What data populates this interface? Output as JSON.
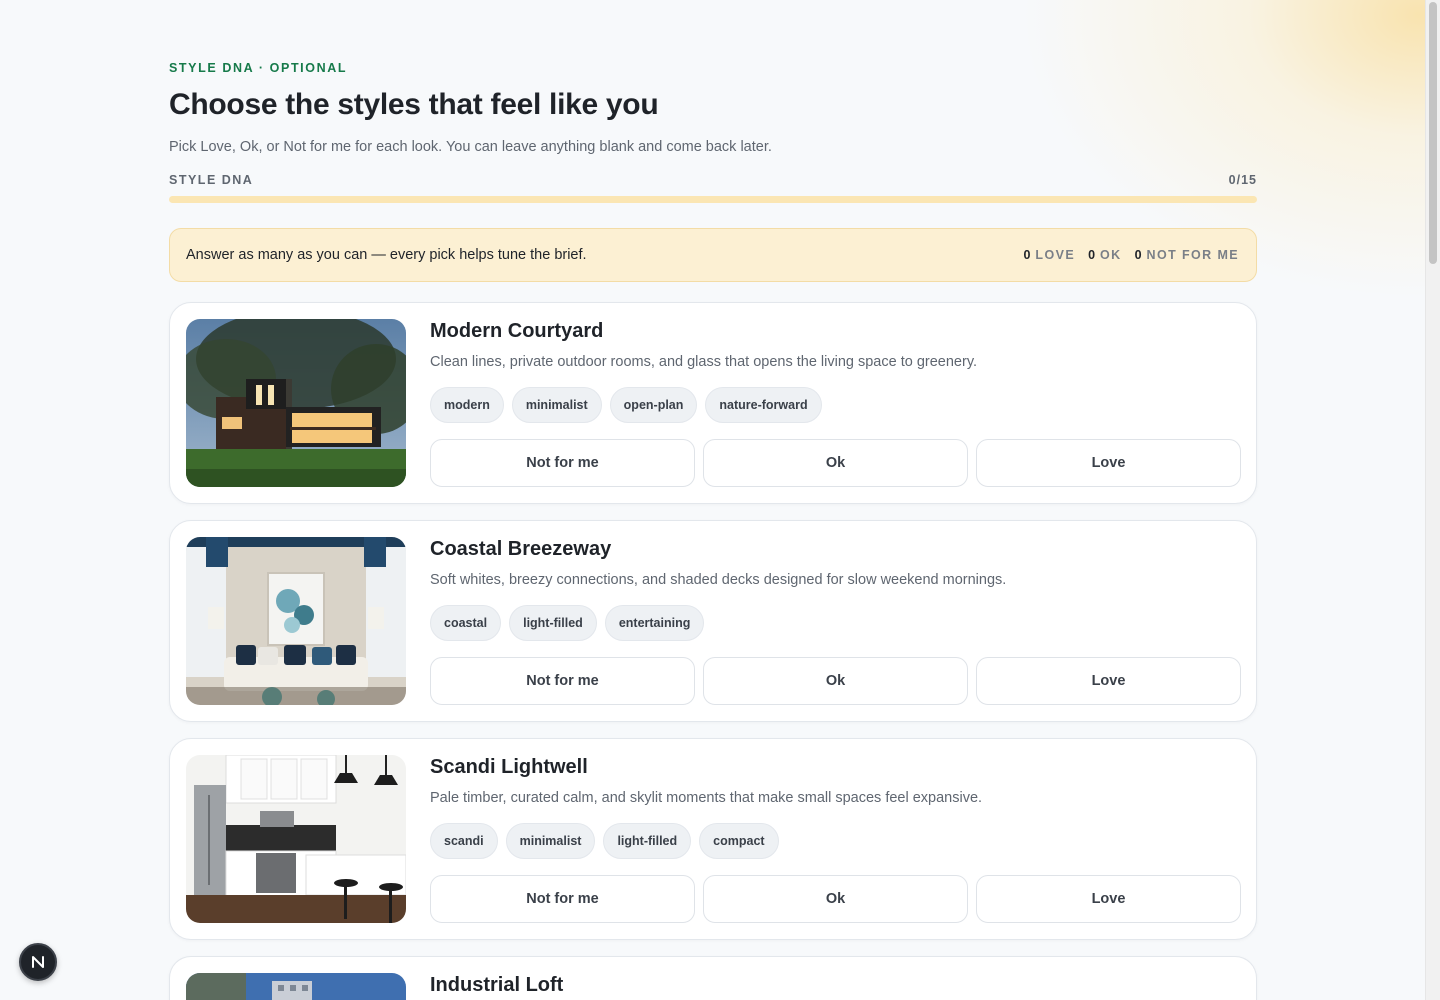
{
  "header": {
    "eyebrow": "STYLE DNA · OPTIONAL",
    "title": "Choose the styles that feel like you",
    "subtitle": "Pick Love, Ok, or Not for me for each look. You can leave anything blank and come back later."
  },
  "progress": {
    "label": "STYLE DNA",
    "count": "0/15",
    "answered": 0,
    "total": 15
  },
  "banner": {
    "text": "Answer as many as you can — every pick helps tune the brief.",
    "love_count": "0",
    "love_label": "LOVE",
    "ok_count": "0",
    "ok_label": "OK",
    "no_count": "0",
    "no_label": "NOT FOR ME"
  },
  "choices": {
    "not_for_me": "Not for me",
    "ok": "Ok",
    "love": "Love"
  },
  "styles": [
    {
      "title": "Modern Courtyard",
      "description": "Clean lines, private outdoor rooms, and glass that opens the living space to greenery.",
      "tags": [
        "modern",
        "minimalist",
        "open-plan",
        "nature-forward"
      ]
    },
    {
      "title": "Coastal Breezeway",
      "description": "Soft whites, breezy connections, and shaded decks designed for slow weekend mornings.",
      "tags": [
        "coastal",
        "light-filled",
        "entertaining"
      ]
    },
    {
      "title": "Scandi Lightwell",
      "description": "Pale timber, curated calm, and skylit moments that make small spaces feel expansive.",
      "tags": [
        "scandi",
        "minimalist",
        "light-filled",
        "compact"
      ]
    },
    {
      "title": "Industrial Loft"
    }
  ],
  "colors": {
    "accent_green": "#167a4a",
    "progress_track": "#fbe6b3",
    "banner_bg": "#fcf0d3"
  },
  "badge": {
    "letter": "N"
  }
}
